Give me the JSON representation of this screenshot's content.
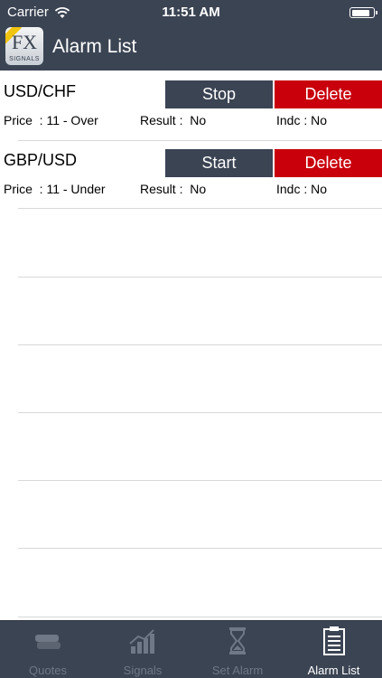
{
  "status_bar": {
    "carrier": "Carrier",
    "time": "11:51 AM",
    "battery_level": 0.9
  },
  "header": {
    "title": "Alarm List",
    "logo_text": "FX",
    "logo_subtext": "SIGNALS"
  },
  "alarms": [
    {
      "pair": "USD/CHF",
      "toggle_label": "Stop",
      "delete_label": "Delete",
      "price": "Price  : 11 - Over",
      "result": "Result :  No",
      "indc": "Indc : No"
    },
    {
      "pair": "GBP/USD",
      "toggle_label": "Start",
      "delete_label": "Delete",
      "price": "Price  : 11 - Under",
      "result": "Result :  No",
      "indc": "Indc : No"
    }
  ],
  "tabs": [
    {
      "label": "Quotes",
      "icon": "quotes-icon",
      "active": false
    },
    {
      "label": "Signals",
      "icon": "signals-icon",
      "active": false
    },
    {
      "label": "Set Alarm",
      "icon": "hourglass-icon",
      "active": false
    },
    {
      "label": "Alarm List",
      "icon": "clipboard-icon",
      "active": true
    }
  ],
  "colors": {
    "header_bg": "#3b4453",
    "delete_bg": "#c9000b",
    "tab_inactive": "#6f7886",
    "tab_active": "#ffffff"
  }
}
